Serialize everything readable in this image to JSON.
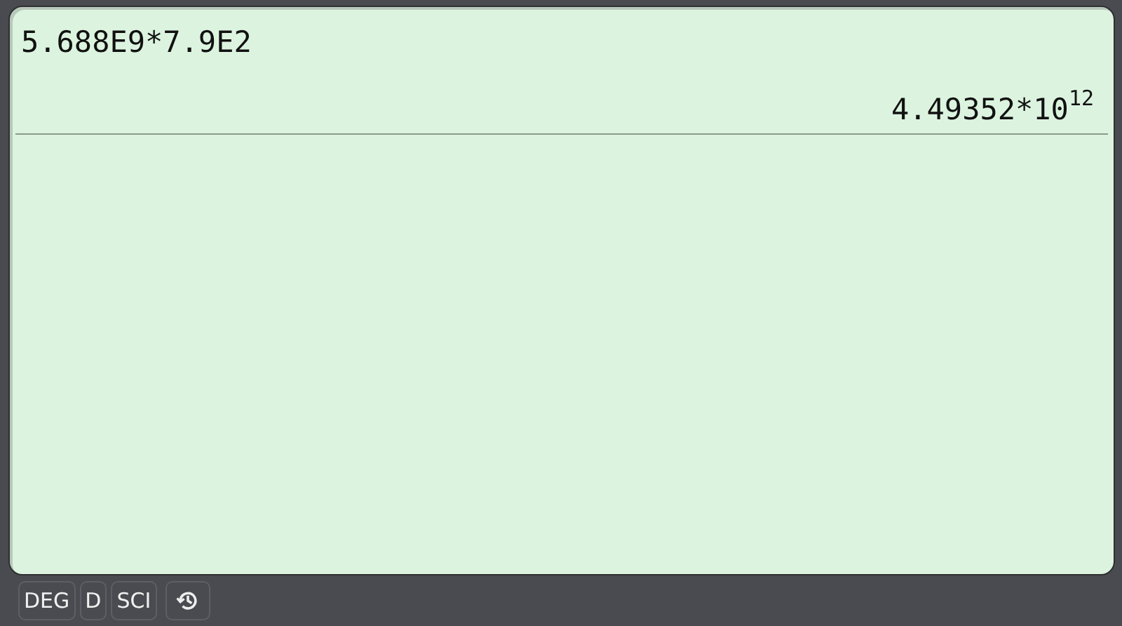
{
  "display": {
    "expression": "5.688E9*7.9E2",
    "result": "4.49352*10$^{12}$"
  },
  "status_bar": {
    "buttons": [
      {
        "label": "DEG"
      },
      {
        "label": "D"
      },
      {
        "label": "SCI"
      }
    ],
    "history": {
      "kind": "history"
    }
  }
}
